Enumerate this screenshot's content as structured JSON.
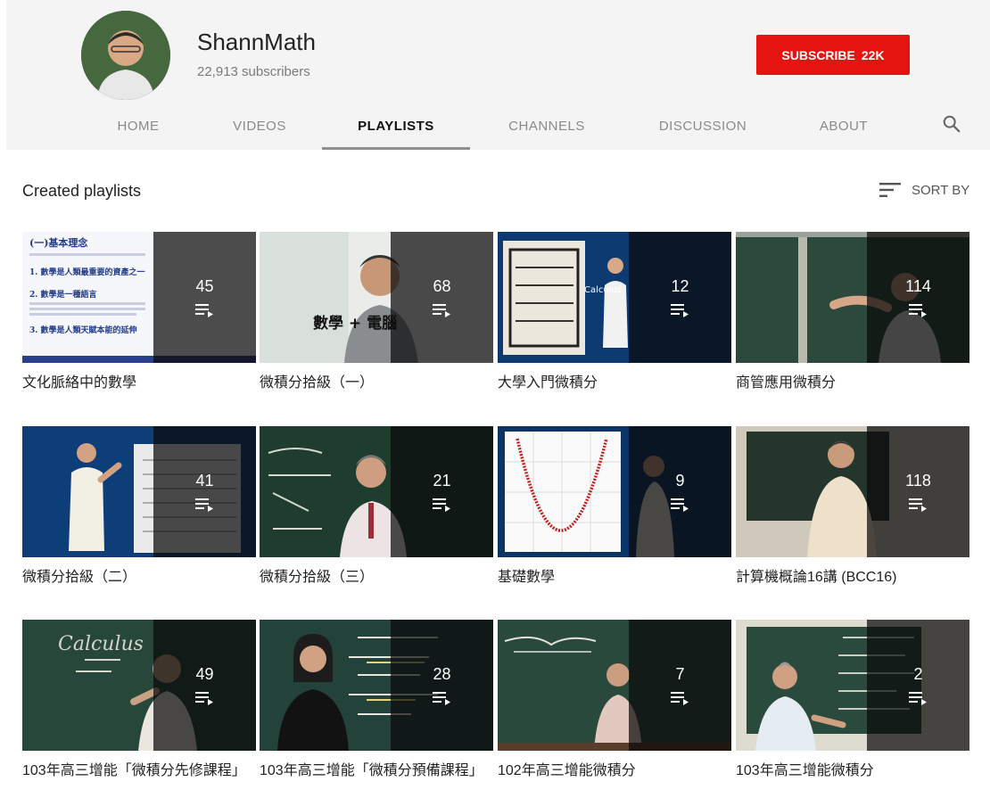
{
  "channel": {
    "name": "ShannMath",
    "subscribers": "22,913 subscribers"
  },
  "subscribe": {
    "label": "SUBSCRIBE",
    "count": "22K"
  },
  "tabs": [
    "HOME",
    "VIDEOS",
    "PLAYLISTS",
    "CHANNELS",
    "DISCUSSION",
    "ABOUT"
  ],
  "active_tab": "PLAYLISTS",
  "section": {
    "title": "Created playlists",
    "sort_label": "SORT BY"
  },
  "playlists": [
    {
      "title": "文化脈絡中的數學",
      "count": "45"
    },
    {
      "title": "微積分拾級（一）",
      "count": "68"
    },
    {
      "title": "大學入門微積分",
      "count": "12"
    },
    {
      "title": "商管應用微積分",
      "count": "114"
    },
    {
      "title": "微積分拾級（二）",
      "count": "41"
    },
    {
      "title": "微積分拾級（三）",
      "count": "21"
    },
    {
      "title": "基礎數學",
      "count": "9"
    },
    {
      "title": "計算機概論16講 (BCC16)",
      "count": "118"
    },
    {
      "title": "103年高三增能「微積分先修課程」",
      "count": "49"
    },
    {
      "title": "103年高三增能「微積分預備課程」",
      "count": "28"
    },
    {
      "title": "102年高三增能微積分",
      "count": "7"
    },
    {
      "title": "103年高三增能微積分",
      "count": "2"
    }
  ],
  "thumbnail_text": {
    "t1": {
      "heading": "(一)基本理念",
      "lines": [
        "1. 數學是人類最重要的資產之一",
        "2. 數學是一種語言",
        "3. 數學是人類天賦本能的延伸"
      ]
    },
    "t2": {
      "caption": "數學 + 電腦"
    },
    "t3": {
      "label": "Calculus"
    },
    "t9": {
      "label": "Calculus"
    }
  },
  "colors": {
    "subscribe": "#e61410",
    "header_bg": "#f4f4f4",
    "overlay": "#0a0a0a"
  },
  "icons": {
    "search": "search-icon",
    "sort": "sort-icon",
    "playlist": "playlist-icon"
  }
}
